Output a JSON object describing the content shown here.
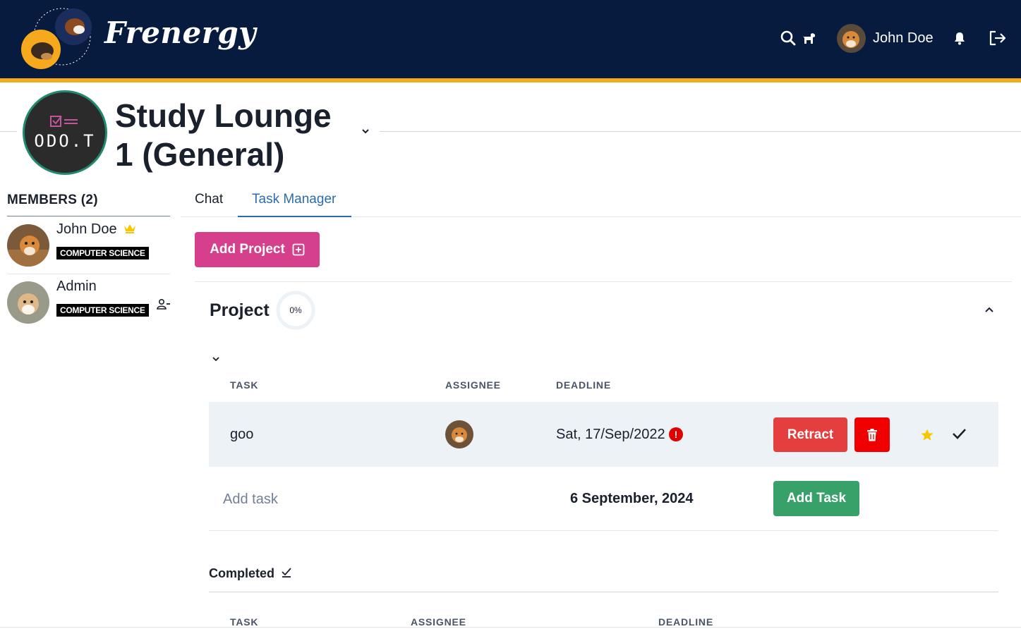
{
  "header": {
    "brand": "Frenergy",
    "user_name": "John Doe",
    "icons": [
      "search-icon",
      "dog-icon",
      "bell-icon",
      "logout-icon"
    ],
    "colors": {
      "bar": "#061b3d",
      "accent_stripe": "#f6a91c"
    }
  },
  "group": {
    "logo_text": "ODO.T",
    "title": "Study Lounge 1 (General)"
  },
  "members": {
    "heading": "MEMBERS (2)",
    "items": [
      {
        "name": "John Doe",
        "badge": "COMPUTER SCIENCE",
        "icon": "crown-icon"
      },
      {
        "name": "Admin",
        "badge": "COMPUTER SCIENCE",
        "icon": "remove-member-icon"
      }
    ]
  },
  "tabs": [
    {
      "label": "Chat",
      "active": false
    },
    {
      "label": "Task Manager",
      "active": true
    }
  ],
  "task_manager": {
    "add_project_label": "Add Project",
    "project": {
      "name": "Project",
      "progress_label": "0%",
      "progress": 0
    },
    "columns": {
      "task": "TASK",
      "assignee": "ASSIGNEE",
      "deadline": "DEADLINE"
    },
    "tasks": [
      {
        "name": "goo",
        "deadline": "Sat, 17/Sep/2022",
        "overdue": "!",
        "retract_label": "Retract"
      }
    ],
    "add_task": {
      "placeholder": "Add task",
      "date": "6 September, 2024",
      "button_label": "Add Task"
    },
    "completed": {
      "title": "Completed",
      "columns": {
        "task": "TASK",
        "assignee": "ASSIGNEE",
        "deadline": "DEADLINE"
      }
    },
    "colors": {
      "add_project": "#d53f8c",
      "retract": "#e53e3e",
      "delete": "#f00000",
      "add_task": "#38a169",
      "active_tab": "#2b6cb0"
    }
  }
}
